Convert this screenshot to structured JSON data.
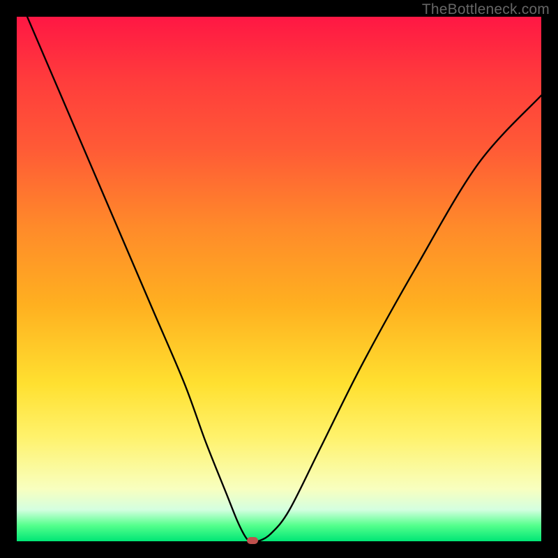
{
  "watermark": "TheBottleneck.com",
  "chart_data": {
    "type": "line",
    "title": "",
    "xlabel": "",
    "ylabel": "",
    "xlim": [
      0,
      100
    ],
    "ylim": [
      0,
      100
    ],
    "grid": false,
    "series": [
      {
        "name": "curve",
        "x": [
          2,
          8,
          14,
          20,
          26,
          32,
          36,
          40,
          42,
          43.5,
          44.5,
          46,
          48.5,
          52,
          58,
          66,
          76,
          88,
          100
        ],
        "y": [
          100,
          86,
          72,
          58,
          44,
          30,
          19,
          9,
          4,
          1,
          0,
          0,
          1.5,
          6,
          18,
          34,
          52,
          72,
          85
        ]
      }
    ],
    "marker": {
      "x": 45,
      "y": 0
    },
    "background_gradient": {
      "top": "#ff1744",
      "mid1": "#ff8a2a",
      "mid2": "#ffe030",
      "bottom": "#00e676"
    }
  }
}
